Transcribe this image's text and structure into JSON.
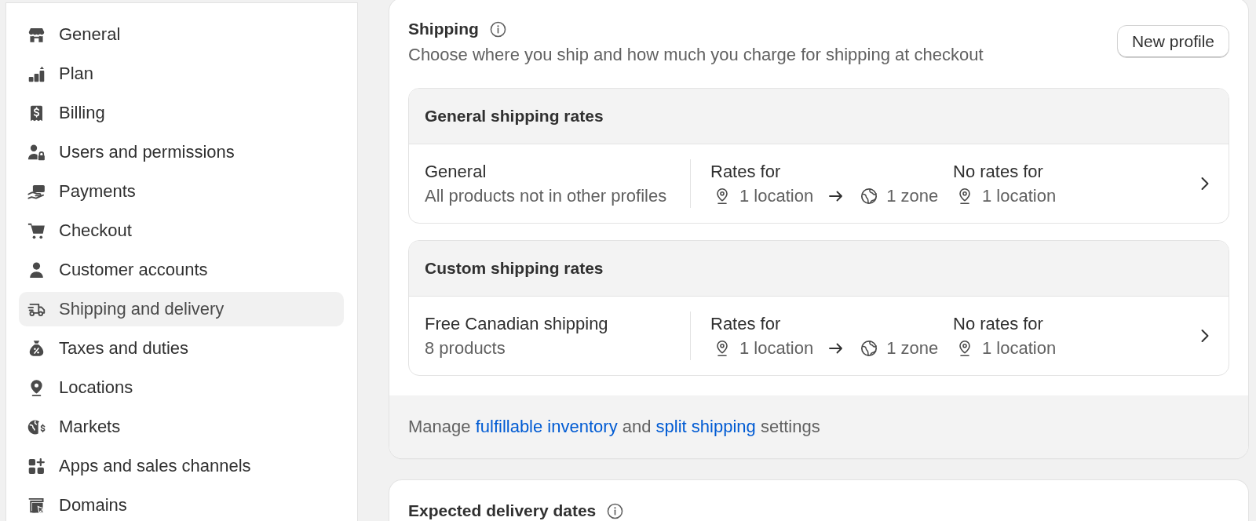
{
  "sidebar": {
    "items": [
      {
        "label": "General",
        "selected": false
      },
      {
        "label": "Plan",
        "selected": false
      },
      {
        "label": "Billing",
        "selected": false
      },
      {
        "label": "Users and permissions",
        "selected": false
      },
      {
        "label": "Payments",
        "selected": false
      },
      {
        "label": "Checkout",
        "selected": false
      },
      {
        "label": "Customer accounts",
        "selected": false
      },
      {
        "label": "Shipping and delivery",
        "selected": true
      },
      {
        "label": "Taxes and duties",
        "selected": false
      },
      {
        "label": "Locations",
        "selected": false
      },
      {
        "label": "Markets",
        "selected": false
      },
      {
        "label": "Apps and sales channels",
        "selected": false
      },
      {
        "label": "Domains",
        "selected": false
      }
    ]
  },
  "shipping_card": {
    "title": "Shipping",
    "description": "Choose where you ship and how much you charge for shipping at checkout",
    "button": "New profile",
    "groups": [
      {
        "heading": "General shipping rates",
        "profiles": [
          {
            "name": "General",
            "detail": "All products not in other profiles",
            "rates_label": "Rates for",
            "rates_location": "1 location",
            "rates_zone": "1 zone",
            "no_rates_label": "No rates for",
            "no_rates_location": "1 location"
          }
        ]
      },
      {
        "heading": "Custom shipping rates",
        "profiles": [
          {
            "name": "Free Canadian shipping",
            "detail": "8 products",
            "rates_label": "Rates for",
            "rates_location": "1 location",
            "rates_zone": "1 zone",
            "no_rates_label": "No rates for",
            "no_rates_location": "1 location"
          }
        ]
      }
    ],
    "footer": [
      {
        "kind": "text",
        "text": "Manage"
      },
      {
        "kind": "link",
        "text": "fulfillable inventory"
      },
      {
        "kind": "text",
        "text": "and"
      },
      {
        "kind": "link",
        "text": "split shipping"
      },
      {
        "kind": "text",
        "text": "settings"
      }
    ]
  },
  "delivery_card": {
    "title": "Expected delivery dates"
  }
}
